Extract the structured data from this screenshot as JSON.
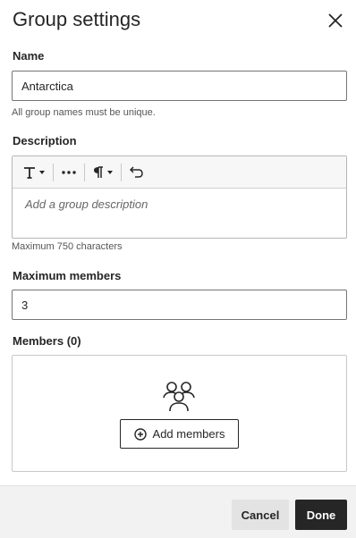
{
  "dialog": {
    "title": "Group settings",
    "close_icon": "close-icon"
  },
  "name_field": {
    "label": "Name",
    "value": "Antarctica",
    "helper": "All group names must be unique."
  },
  "description": {
    "label": "Description",
    "toolbar": [
      "text-format-icon",
      "more-options-icon",
      "paragraph-icon",
      "undo-icon"
    ],
    "placeholder": "Add a group description",
    "helper": "Maximum 750 characters"
  },
  "max_members": {
    "label": "Maximum members",
    "value": "3"
  },
  "members": {
    "label": "Members (0)",
    "add_label": "Add members",
    "empty_icon": "group-icon"
  },
  "footer": {
    "cancel_label": "Cancel",
    "done_label": "Done"
  },
  "colors": {
    "primary": "#262626",
    "cancel_bg": "#e3e3e3",
    "footer_bg": "#f2f2f2"
  }
}
